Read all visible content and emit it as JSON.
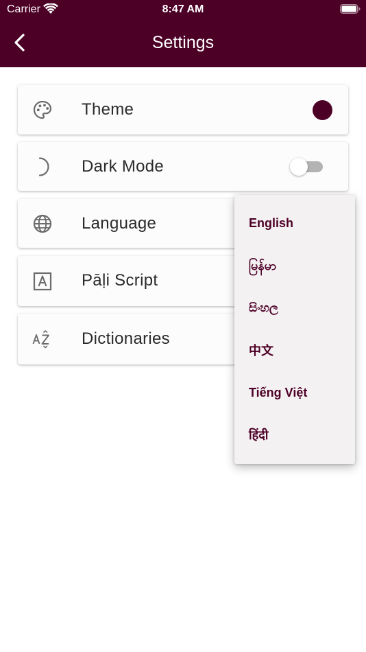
{
  "status_bar": {
    "carrier": "Carrier",
    "time": "8:47 AM"
  },
  "app_bar": {
    "title": "Settings",
    "back_icon": "chevron-left-icon"
  },
  "settings": [
    {
      "label": "Theme",
      "icon": "palette-icon",
      "control": "color-dot",
      "color": "#4d0026"
    },
    {
      "label": "Dark Mode",
      "icon": "moon-icon",
      "control": "switch",
      "enabled": false
    },
    {
      "label": "Language",
      "icon": "globe-icon"
    },
    {
      "label": "Pāḷi Script",
      "icon": "script-letter-icon"
    },
    {
      "label": "Dictionaries",
      "icon": "sort-az-icon"
    }
  ],
  "language_menu": {
    "options": [
      "English",
      "မြန်မာ",
      "සිංහල",
      "中文",
      "Tiếng Việt",
      "हिंदी"
    ]
  },
  "colors": {
    "primary": "#4d0026",
    "menu_background": "#f4f1f3",
    "card_background": "#fdfcfd"
  }
}
